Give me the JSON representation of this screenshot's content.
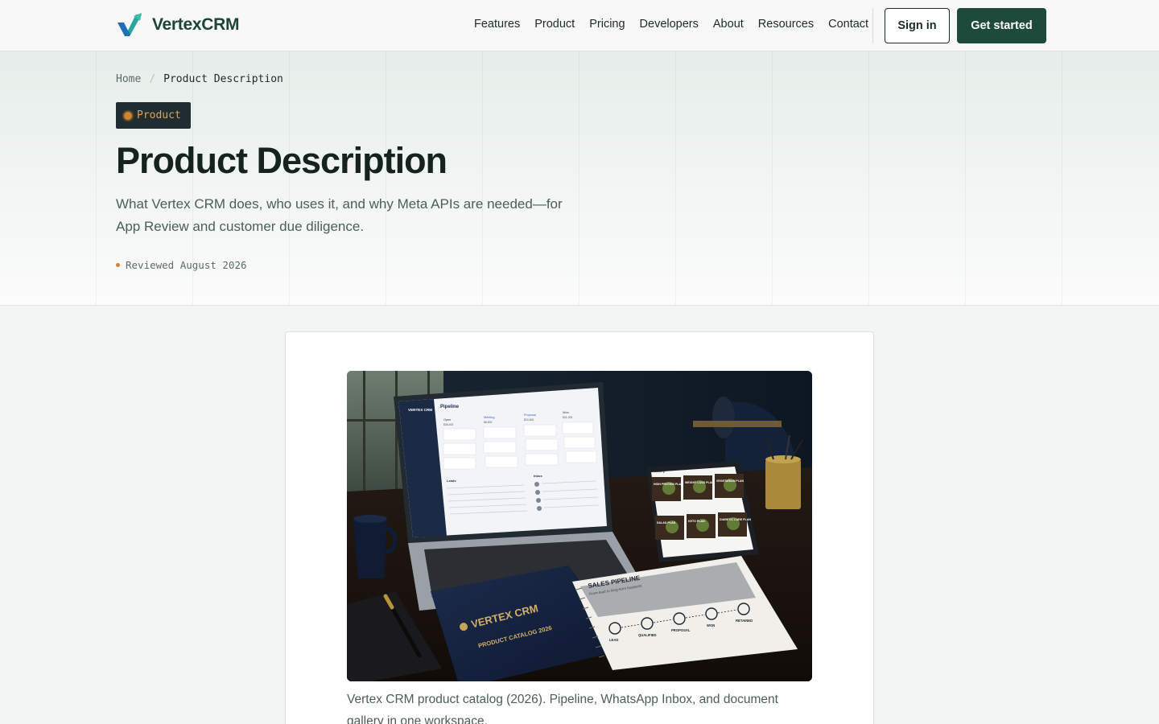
{
  "header": {
    "brand": "VertexCRM",
    "nav": [
      "Features",
      "Product",
      "Pricing",
      "Developers",
      "About",
      "Resources",
      "Contact"
    ],
    "signin_label": "Sign in",
    "cta_label": "Get started"
  },
  "hero": {
    "breadcrumb": {
      "home": "Home",
      "separator": "/",
      "current": "Product Description"
    },
    "tag": "Product",
    "title": "Product Description",
    "subtitle": "What Vertex CRM does, who uses it, and why Meta APIs are needed—for App Review and customer due diligence.",
    "reviewed": "Reviewed August 2026"
  },
  "figure": {
    "caption": "Vertex CRM product catalog (2026). Pipeline, WhatsApp Inbox, and document gallery in one workspace.",
    "laptop_screen": {
      "app": "VERTEX CRM",
      "heading": "Pipeline",
      "columns": [
        "Open",
        "Meeting",
        "Proposal",
        "Won"
      ],
      "column_totals": [
        "$35,400",
        "$6,500",
        "$24,500",
        "$31,200"
      ],
      "leads_heading": "Leads",
      "inbox_heading": "Inbox"
    },
    "tablet_screen": {
      "heading": "Gallery",
      "tiles": [
        "HIGH PROTEIN PLAN",
        "WEIGHT LOSS PLAN",
        "VEGETARIAN PLAN",
        "SALAD PLAN",
        "KETO PLAN",
        "DIABETIC CARE PLAN"
      ]
    },
    "catalog": {
      "brand": "VERTEX CRM",
      "subtitle": "PRODUCT CATALOG 2026"
    },
    "brochure": {
      "title": "SALES PIPELINE",
      "subtitle": "From lead to long-term business",
      "steps": [
        "LEAD",
        "QUALIFIED",
        "PROPOSAL",
        "WON",
        "RETAINED"
      ]
    }
  },
  "colors": {
    "brand_green": "#1d4a3b",
    "accent_orange": "#d0842f",
    "tag_bg": "#1f2d30",
    "text_dark": "#16221f",
    "text_muted": "#4d5d59"
  },
  "icons": {
    "brand": "vertex-check-logo-icon",
    "tag": "status-dot-icon"
  }
}
